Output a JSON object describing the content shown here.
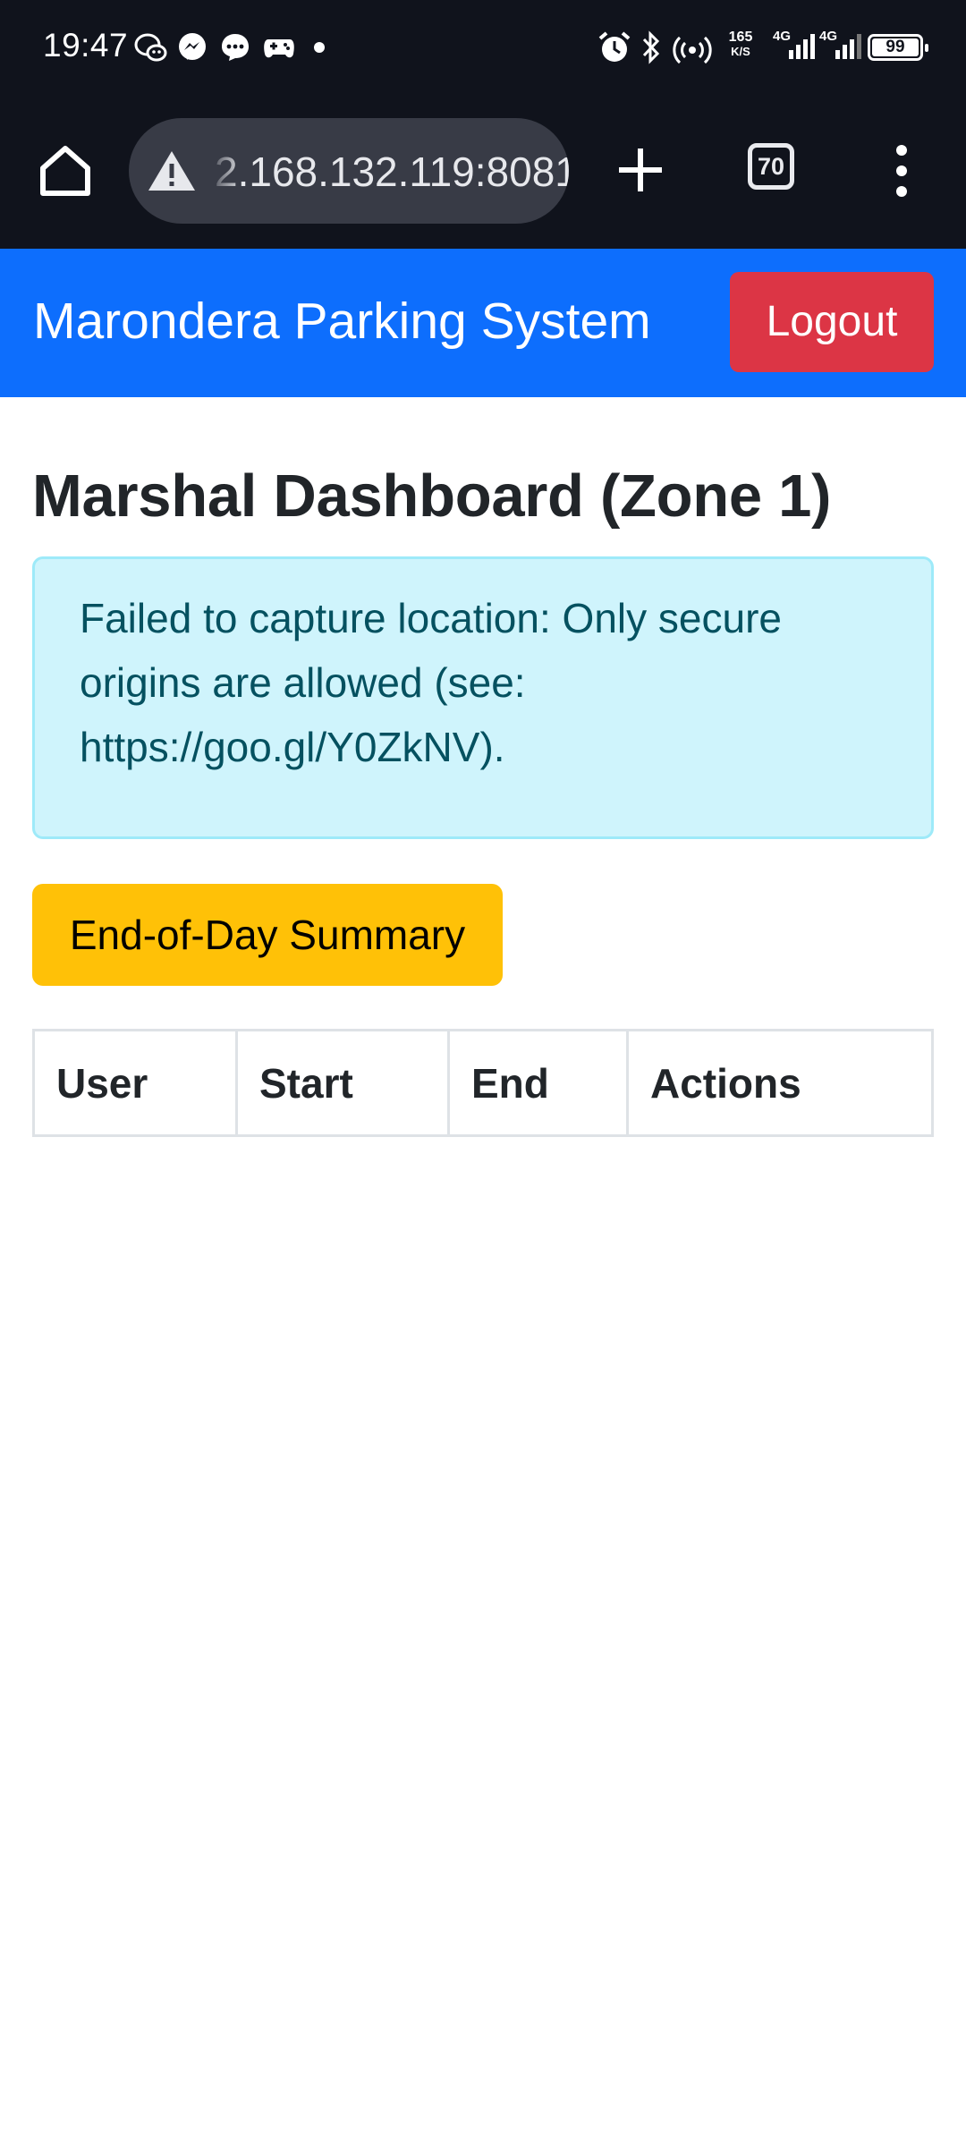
{
  "status_bar": {
    "time": "19:47",
    "net_speed_value": "165",
    "net_speed_unit": "K/S",
    "signal_1_label": "4G",
    "signal_2_label": "4G",
    "battery": "99",
    "notification_icons": [
      "wechat-icon",
      "messenger-icon",
      "chat-icon",
      "game-icon",
      "dot-icon"
    ],
    "system_icons": [
      "alarm-icon",
      "bluetooth-icon",
      "hotspot-icon"
    ]
  },
  "browser": {
    "url": "2.168.132.119:8081",
    "tab_count": "70",
    "icons": [
      "home-icon",
      "not-secure-warning-icon",
      "new-tab-plus-icon",
      "tab-switcher-icon",
      "more-vert-icon"
    ]
  },
  "navbar": {
    "brand": "Marondera Parking System",
    "logout_label": "Logout"
  },
  "main": {
    "title": "Marshal Dashboard (Zone 1)",
    "alert_text": "Failed to capture location: Only secure origins are allowed (see: https://goo.gl/Y0ZkNV).",
    "summary_button_label": "End-of-Day Summary",
    "table": {
      "headers": [
        "User",
        "Start",
        "End",
        "Actions"
      ],
      "rows": []
    }
  },
  "colors": {
    "navbar": "#0d6efd",
    "logout": "#dc3545",
    "summary_button": "#ffc107",
    "alert_bg": "#cff4fc",
    "alert_text": "#055160",
    "chrome_bg": "#10131c"
  }
}
